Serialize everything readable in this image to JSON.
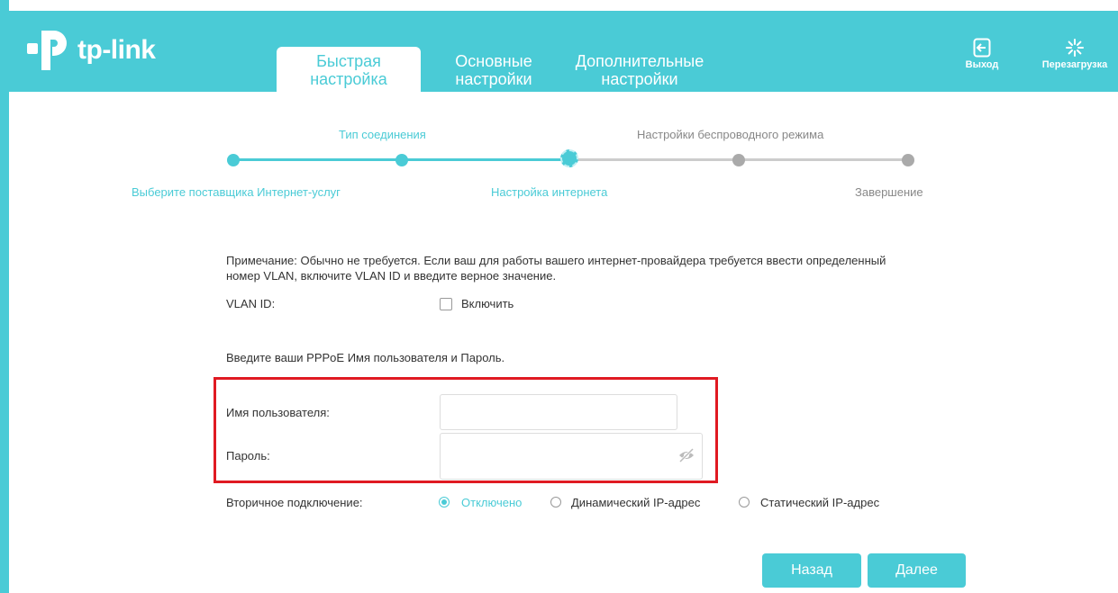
{
  "header": {
    "logo_text": "tp-link",
    "tabs": [
      {
        "line1": "Быстрая",
        "line2": "настройка",
        "active": true
      },
      {
        "line1": "Основные",
        "line2": "настройки",
        "active": false
      },
      {
        "line1": "Дополнительные",
        "line2": "настройки",
        "active": false
      }
    ],
    "logout_label": "Выход",
    "reboot_label": "Перезагрузка"
  },
  "progress": {
    "top_labels": [
      "Тип соединения",
      "Настройки беспроводного режима"
    ],
    "bottom_labels": [
      "Выберите поставщика Интернет-услуг",
      "Настройка интернета",
      "Завершение"
    ],
    "current_step": 3,
    "total_steps": 5
  },
  "form": {
    "note": "Примечание: Обычно не требуется. Если ваш для работы вашего интернет-провайдера требуется ввести определенный",
    "note_line2": "номер VLAN, включите VLAN ID и введите верное значение.",
    "vlan_label": "VLAN ID:",
    "vlan_checkbox_label": "Включить",
    "pppoe_prompt": "Введите ваши PPPoE Имя пользователя и Пароль.",
    "username_label": "Имя пользователя:",
    "username_value": "",
    "password_label": "Пароль:",
    "password_value": "",
    "secondary_label": "Вторичное подключение:",
    "secondary_options": [
      "Отключено",
      "Динамический IP-адрес",
      "Статический IP-адрес"
    ],
    "secondary_selected": "Отключено"
  },
  "buttons": {
    "back": "Назад",
    "next": "Далее"
  },
  "colors": {
    "accent": "#4acbd6",
    "highlight": "#e01a22",
    "inactive": "#aaaaaa"
  }
}
